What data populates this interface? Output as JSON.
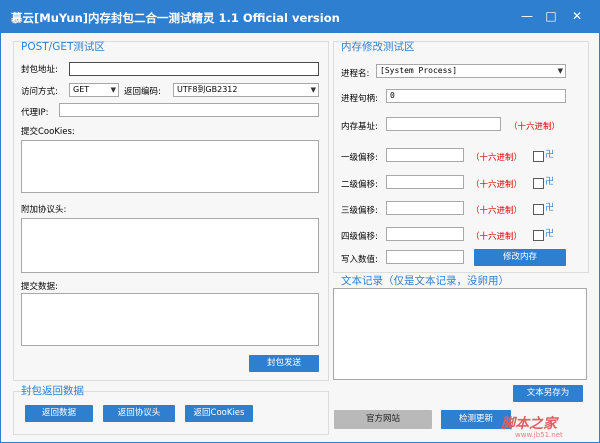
{
  "window": {
    "title": "慕云[MuYun]内存封包二合一测试精灵 1.1 Official version",
    "minimize_glyph": "—",
    "maximize_glyph": "□",
    "close_glyph": "✕"
  },
  "post_get": {
    "section_title": "POST/GET测试区",
    "url_label": "封包地址:",
    "url_value": "",
    "method_label": "访问方式:",
    "method_value": "GET",
    "encoding_label": "返回编码:",
    "encoding_value": "UTF8到GB2312",
    "proxy_label": "代理IP:",
    "proxy_value": "",
    "cookies_label": "提交CooKies:",
    "headers_label": "附加协议头:",
    "data_label": "提交数据:",
    "send_button": "封包发送"
  },
  "return_data": {
    "section_title": "封包返回数据",
    "buttons": [
      "返回数据",
      "返回协议头",
      "返回CooKies"
    ]
  },
  "memory": {
    "section_title": "内存修改测试区",
    "process_label": "进程名:",
    "process_value": "[System Process]",
    "handle_label": "进程句柄:",
    "handle_value": "0",
    "base_label": "内存基址:",
    "base_value": "",
    "hex_hint": "（十六进制）",
    "offset_labels": [
      "一级偏移:",
      "二级偏移:",
      "三级偏移:",
      "四级偏移:"
    ],
    "offset_values": [
      "",
      "",
      "",
      ""
    ],
    "write_label": "写入数值:",
    "write_value": "",
    "modify_button": "修改内存"
  },
  "text_log": {
    "section_title": "文本记录（仅是文本记录，没卵用）",
    "save_button": "文本另存为"
  },
  "footer": {
    "website_button": "官方网站",
    "update_button": "检测更新"
  },
  "watermark": {
    "text": "脚本之家",
    "subtext": "www.jb51.net"
  }
}
